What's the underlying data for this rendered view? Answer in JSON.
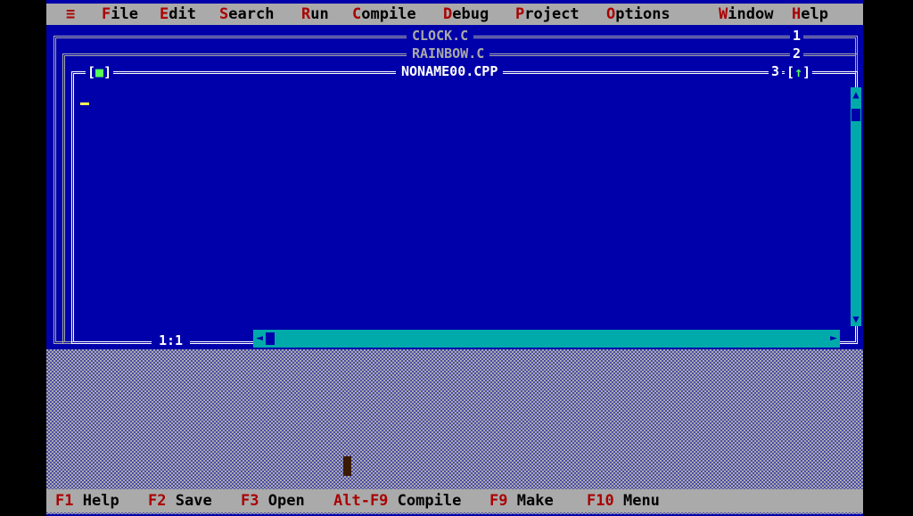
{
  "menubar": {
    "system": "≡",
    "items": [
      {
        "hot": "F",
        "rest": "ile"
      },
      {
        "hot": "E",
        "rest": "dit"
      },
      {
        "hot": "S",
        "rest": "earch"
      },
      {
        "hot": "R",
        "rest": "un"
      },
      {
        "hot": "C",
        "rest": "ompile"
      },
      {
        "hot": "D",
        "rest": "ebug"
      },
      {
        "hot": "P",
        "rest": "roject"
      },
      {
        "hot": "O",
        "rest": "ptions"
      },
      {
        "hot": "W",
        "rest": "indow"
      },
      {
        "hot": "H",
        "rest": "elp"
      }
    ]
  },
  "windows": [
    {
      "title": "CLOCK.C",
      "number": "1"
    },
    {
      "title": "RAINBOW.C",
      "number": "2"
    },
    {
      "title": "NONAME00.CPP",
      "number": "3"
    }
  ],
  "editor": {
    "close_box": "■",
    "zoom_box": "↑",
    "cursor_position": "1:1"
  },
  "statusbar": {
    "items": [
      {
        "key": "F1",
        "label": "Help"
      },
      {
        "key": "F2",
        "label": "Save"
      },
      {
        "key": "F3",
        "label": "Open"
      },
      {
        "key": "Alt-F9",
        "label": "Compile"
      },
      {
        "key": "F9",
        "label": "Make"
      },
      {
        "key": "F10",
        "label": "Menu"
      }
    ]
  },
  "colors": {
    "desktop_blue": "#0000aa",
    "menu_gray": "#aaaaaa",
    "hotkey_red": "#aa0000",
    "scrollbar_cyan": "#00aaaa",
    "cursor_yellow": "#ffff55"
  }
}
